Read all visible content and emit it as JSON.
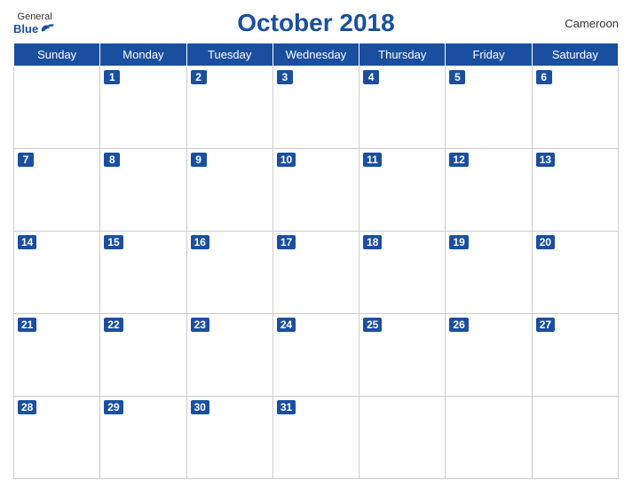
{
  "header": {
    "logo": {
      "general": "General",
      "blue": "Blue"
    },
    "title": "October 2018",
    "country": "Cameroon"
  },
  "days_of_week": [
    "Sunday",
    "Monday",
    "Tuesday",
    "Wednesday",
    "Thursday",
    "Friday",
    "Saturday"
  ],
  "weeks": [
    [
      null,
      1,
      2,
      3,
      4,
      5,
      6
    ],
    [
      7,
      8,
      9,
      10,
      11,
      12,
      13
    ],
    [
      14,
      15,
      16,
      17,
      18,
      19,
      20
    ],
    [
      21,
      22,
      23,
      24,
      25,
      26,
      27
    ],
    [
      28,
      29,
      30,
      31,
      null,
      null,
      null
    ]
  ]
}
